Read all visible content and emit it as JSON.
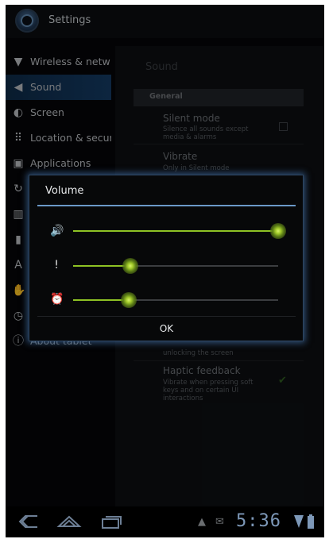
{
  "app": {
    "title": "Settings",
    "icon": "settings-app-icon"
  },
  "sidebar": {
    "items": [
      {
        "label": "Wireless & netw",
        "icon": "wifi-icon",
        "glyph": "▼"
      },
      {
        "label": "Sound",
        "icon": "speaker-icon",
        "glyph": "◀",
        "selected": true
      },
      {
        "label": "Screen",
        "icon": "brightness-icon",
        "glyph": "◐"
      },
      {
        "label": "Location & secur",
        "icon": "location-grid-icon",
        "glyph": "⠿"
      },
      {
        "label": "Applications",
        "icon": "applications-icon",
        "glyph": "▣"
      },
      {
        "label": "",
        "icon": "sync-icon",
        "glyph": "↻"
      },
      {
        "label": "",
        "icon": "privacy-icon",
        "glyph": "▥"
      },
      {
        "label": "",
        "icon": "storage-icon",
        "glyph": "▮"
      },
      {
        "label": "",
        "icon": "language-icon",
        "glyph": "A"
      },
      {
        "label": "",
        "icon": "accessibility-icon",
        "glyph": "✋"
      },
      {
        "label": "",
        "icon": "date-time-icon",
        "glyph": "◷"
      },
      {
        "label": "About tablet",
        "icon": "info-icon",
        "glyph": "ⓘ"
      }
    ]
  },
  "pane": {
    "title": "Sound",
    "section": "General",
    "prefs": [
      {
        "title": "Silent mode",
        "summary": "Silence all sounds except media & alarms",
        "checked": false
      },
      {
        "title": "Vibrate",
        "summary": "Only in Silent mode"
      },
      {
        "title": "",
        "summary": "unlocking the screen"
      },
      {
        "title": "Haptic feedback",
        "summary": "Vibrate when pressing soft keys and on certain UI interactions",
        "checked": true
      }
    ]
  },
  "dialog": {
    "title": "Volume",
    "ok_label": "OK",
    "sliders": [
      {
        "name": "media-volume",
        "icon": "media-speaker-icon",
        "glyph": "🔊",
        "level": 1.0
      },
      {
        "name": "notification-volume",
        "icon": "notification-icon",
        "glyph": "!",
        "level": 0.28
      },
      {
        "name": "alarm-volume",
        "icon": "alarm-clock-icon",
        "glyph": "⏰",
        "level": 0.27
      }
    ],
    "accent_color": "#6a98c8",
    "slider_color": "#8ec224"
  },
  "navbar": {
    "buttons": [
      "back-icon",
      "home-icon",
      "recent-apps-icon"
    ],
    "status_icons": [
      "android-debug-icon",
      "email-icon",
      "wifi-signal-icon",
      "battery-icon"
    ],
    "time": "5:36"
  }
}
